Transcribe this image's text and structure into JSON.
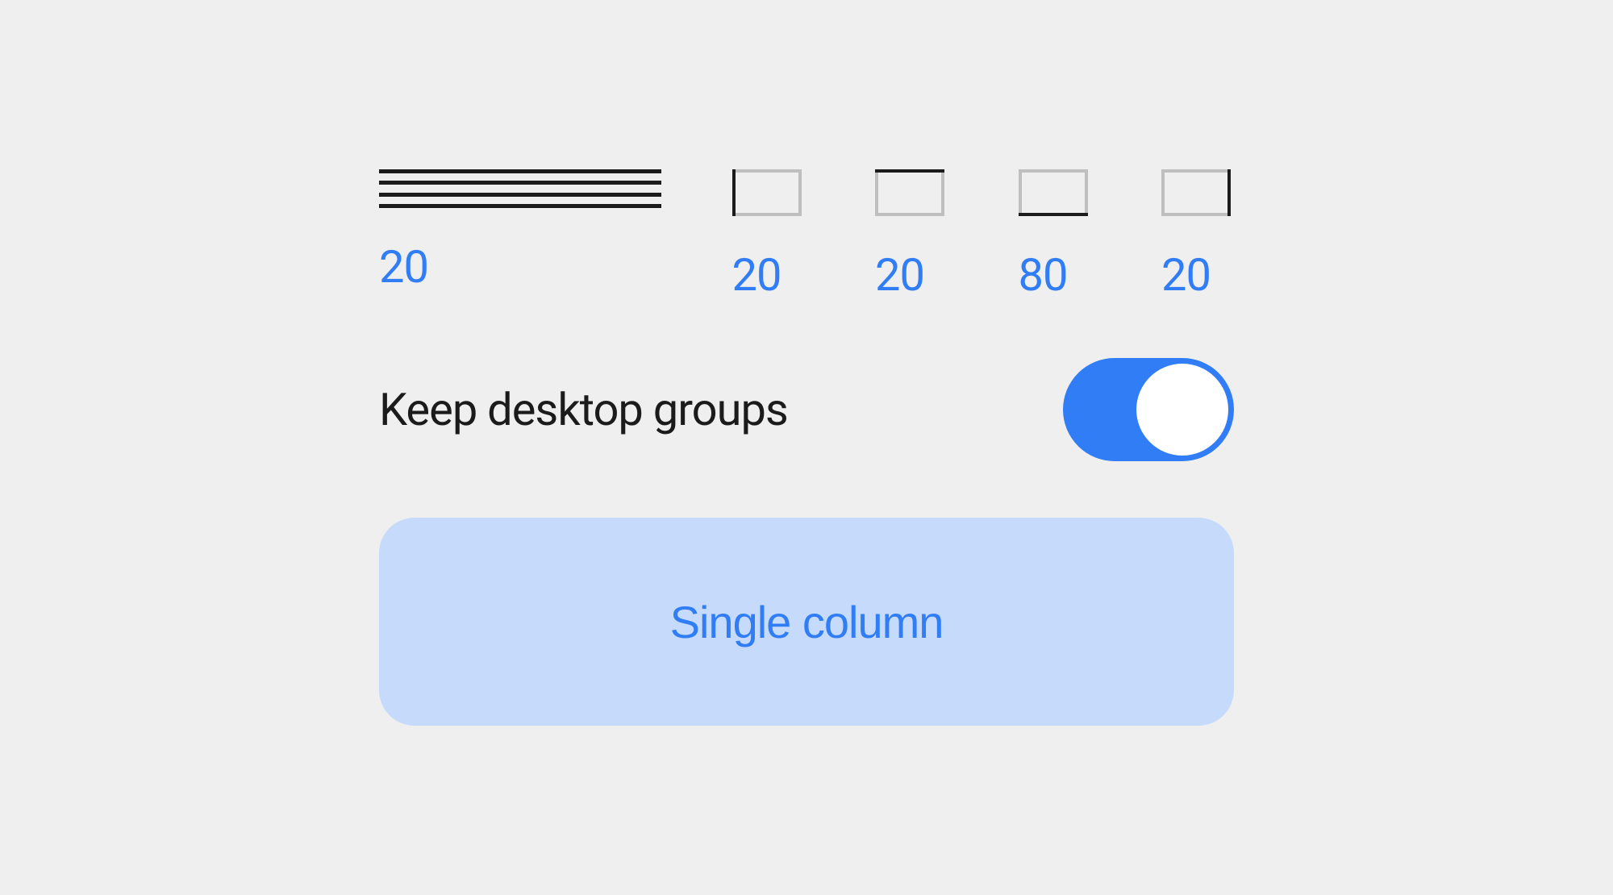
{
  "spacing": {
    "items": [
      {
        "value": "20",
        "kind": "lines"
      },
      {
        "value": "20",
        "kind": "box-left"
      },
      {
        "value": "20",
        "kind": "box-top"
      },
      {
        "value": "80",
        "kind": "box-bottom"
      },
      {
        "value": "20",
        "kind": "box-right"
      }
    ]
  },
  "toggle": {
    "label": "Keep desktop groups",
    "on": true
  },
  "button": {
    "label": "Single column"
  },
  "colors": {
    "accent": "#307df6",
    "button_bg": "#c6dbfb",
    "text": "#1b1b1b",
    "bg": "#efefef"
  }
}
